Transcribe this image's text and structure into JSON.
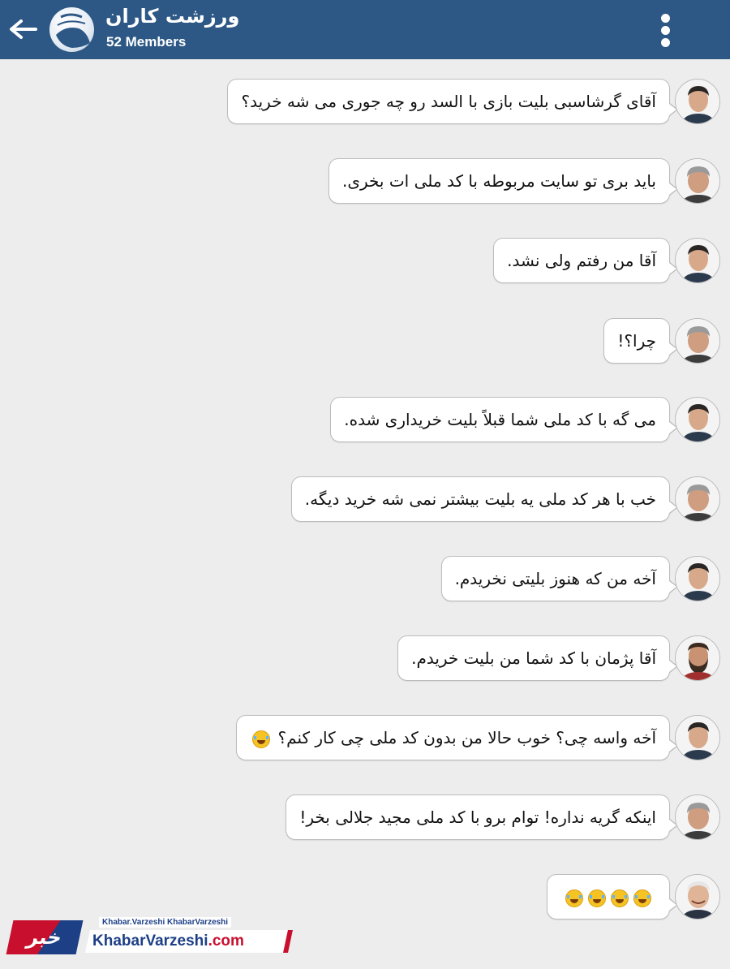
{
  "header": {
    "group_name": "ورزشت کاران",
    "member_count": "52 Members"
  },
  "messages": [
    {
      "text": "آقای گرشاسبی بلیت بازی با السد رو چه جوری می شه خرید؟",
      "sender": "man-short-hair"
    },
    {
      "text": "باید بری تو سایت مربوطه با کد ملی ات بخری.",
      "sender": "man-grey-hair"
    },
    {
      "text": "آقا من رفتم ولی نشد.",
      "sender": "man-short-hair"
    },
    {
      "text": "چرا؟!",
      "sender": "man-grey-hair"
    },
    {
      "text": "می گه با کد ملی شما قبلاً بلیت خریداری شده.",
      "sender": "man-short-hair"
    },
    {
      "text": "خب با هر کد ملی یه بلیت بیشتر نمی شه خرید دیگه.",
      "sender": "man-grey-hair"
    },
    {
      "text": "آخه من که هنوز بلیتی نخریدم.",
      "sender": "man-short-hair"
    },
    {
      "text": "آقا پژمان با کد شما من بلیت خریدم.",
      "sender": "man-beard"
    },
    {
      "text": "آخه واسه چی؟ خوب حالا من بدون کد ملی چی کار کنم؟",
      "sender": "man-short-hair",
      "emoji": "crying-face"
    },
    {
      "text": "اینکه گریه نداره! توام برو با کد ملی مجید جلالی بخر!",
      "sender": "man-grey-hair"
    },
    {
      "text": "",
      "sender": "man-old-smiling",
      "emoji": "laughing-tears x4"
    }
  ],
  "watermark": {
    "logo_text": "خبر",
    "handles": "Khabar.Varzeshi  KhabarVarzeshi",
    "site": "KhabarVarzeshi",
    "site_tld": ".com"
  },
  "colors": {
    "header_bg": "#2d5886",
    "chat_bg": "#ededed",
    "bubble_bg": "#ffffff",
    "brand_red": "#c8102e",
    "brand_blue": "#1d3f86"
  }
}
